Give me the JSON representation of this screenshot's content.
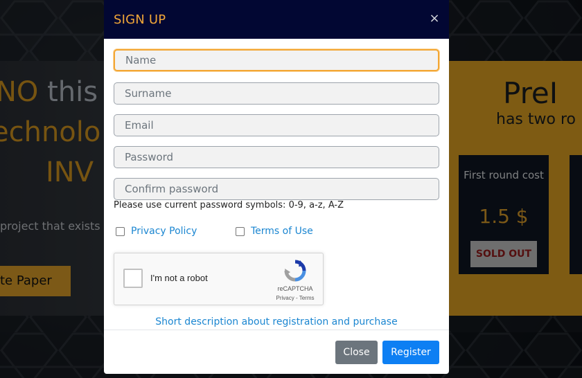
{
  "background": {
    "hero_accent": "NO",
    "hero_rest": " this",
    "hero_line2": "echnolo",
    "hero_line3": "INV",
    "hero_desc": "project that exists i",
    "white_paper_button": "te Paper",
    "preico_title": "PreI",
    "preico_subtitle": "has two ro",
    "round_card": {
      "label": "First round cost",
      "price": "1.5 $",
      "status": "SOLD OUT"
    },
    "colors": {
      "accent": "#e2a32a",
      "dark_card": "#0f1724",
      "sold_out_text": "#9a1c1c"
    }
  },
  "modal": {
    "title": "SIGN UP",
    "close_symbol": "×",
    "fields": {
      "name": {
        "placeholder": "Name",
        "value": ""
      },
      "surname": {
        "placeholder": "Surname",
        "value": ""
      },
      "email": {
        "placeholder": "Email",
        "value": ""
      },
      "password": {
        "placeholder": "Password",
        "value": ""
      },
      "confirm": {
        "placeholder": "Confirm password",
        "value": ""
      }
    },
    "password_hint": "Please use current password symbols: 0-9, a-z, A-Z",
    "privacy_label": "Privacy Policy",
    "terms_label": "Terms of Use",
    "captcha": {
      "label": "I'm not a robot",
      "brand": "reCAPTCHA",
      "links": "Privacy - Terms",
      "icon": "recaptcha-logo-icon"
    },
    "description_link": "Short description about registration and purchase",
    "close_button": "Close",
    "register_button": "Register",
    "colors": {
      "header_bg": "#020733",
      "title": "#f1a638",
      "link": "#1b86d1",
      "register": "#0d7ff3",
      "close": "#6c757d",
      "focus": "#f3a633"
    }
  }
}
